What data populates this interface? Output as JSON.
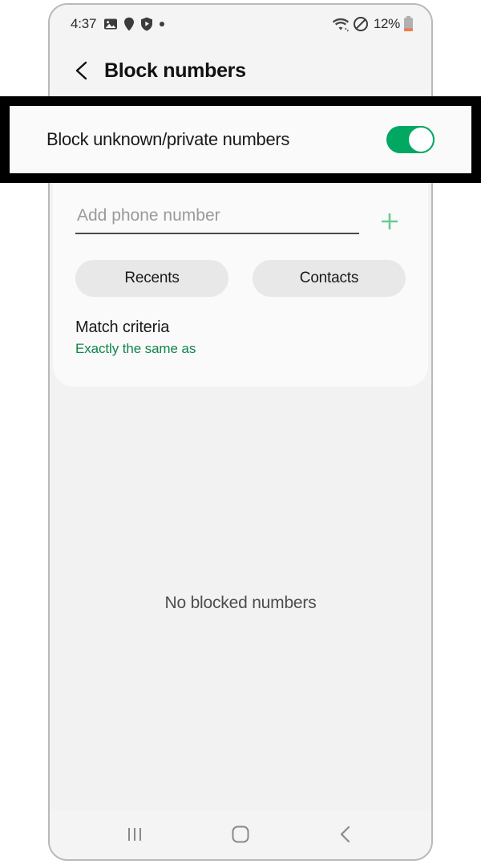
{
  "status_bar": {
    "time": "4:37",
    "left_icons": [
      "image-icon",
      "location-pin-icon",
      "shield-play-icon",
      "dot-icon"
    ],
    "right_icons": [
      "wifi-icon",
      "mute-icon",
      "battery-icon"
    ],
    "battery_percent": "12%"
  },
  "header": {
    "back_label": "Back",
    "title": "Block numbers"
  },
  "callout": {
    "label": "Block unknown/private numbers",
    "toggle_state": "on"
  },
  "main": {
    "toggle_row": {
      "label": "Block unknown/private numbers",
      "toggle_state": "on"
    },
    "phone_input": {
      "placeholder": "Add phone number",
      "value": "",
      "add_button_label": "+"
    },
    "chips": [
      {
        "label": "Recents"
      },
      {
        "label": "Contacts"
      }
    ],
    "match_criteria": {
      "title": "Match criteria",
      "value": "Exactly the same as"
    },
    "empty_state": "No blocked numbers"
  },
  "nav_bar": {
    "recents_label": "Recents",
    "home_label": "Home",
    "back_label": "Back"
  },
  "colors": {
    "accent_green": "#00a862",
    "value_green": "#11854a",
    "plus_green": "#6bcb8e",
    "battery_low": "#f07a4b",
    "screen_bg": "#f2f2f2",
    "card_bg": "#fafafa"
  }
}
